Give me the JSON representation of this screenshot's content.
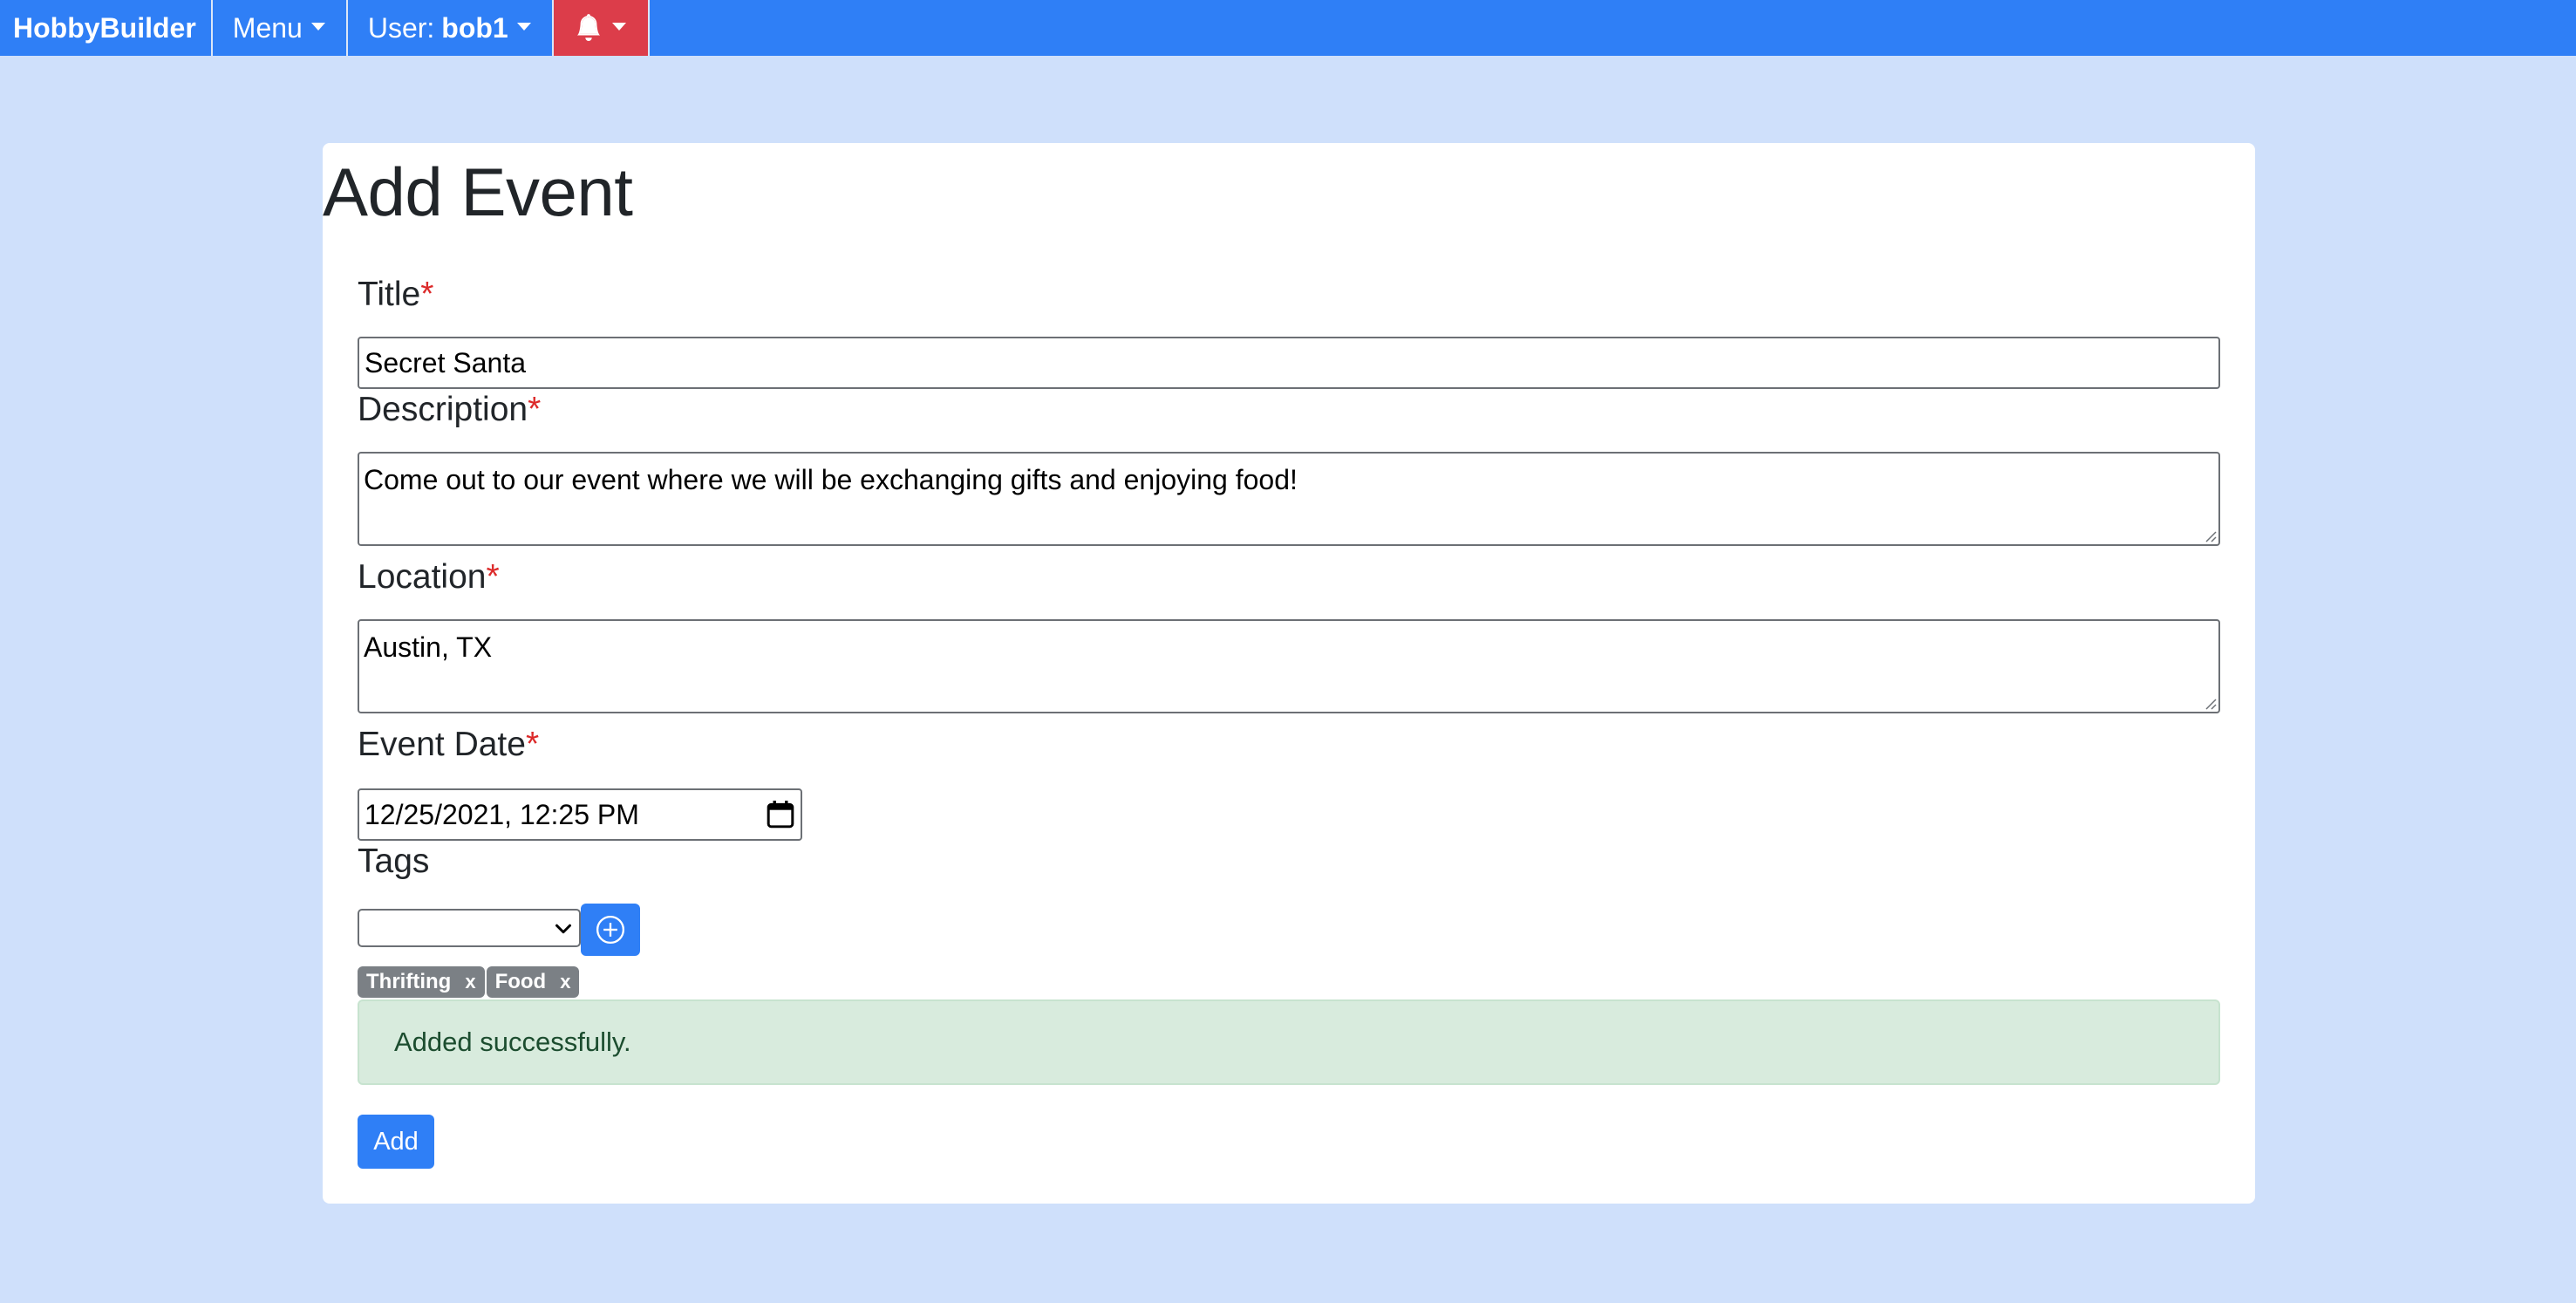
{
  "navbar": {
    "brand": "HobbyBuilder",
    "menu_label": "Menu",
    "user_prefix": "User:",
    "username": "bob1",
    "notifications_icon": "bell-icon"
  },
  "form": {
    "page_title": "Add Event",
    "required_marker": "*",
    "title": {
      "label": "Title",
      "value": "Secret Santa"
    },
    "description": {
      "label": "Description",
      "value": "Come out to our event where we will be exchanging gifts and enjoying food!"
    },
    "location": {
      "label": "Location",
      "value": "Austin, TX"
    },
    "event_date": {
      "label": "Event Date",
      "value": "12/25/2021, 12:25 PM",
      "icon": "calendar-icon"
    },
    "tags": {
      "label": "Tags",
      "selected": "",
      "add_icon": "plus-circle-icon",
      "items": [
        {
          "name": "Thrifting",
          "remove": "x"
        },
        {
          "name": "Food",
          "remove": "x"
        }
      ]
    },
    "alert": "Added successfully.",
    "submit_label": "Add"
  },
  "colors": {
    "primary": "#2f7ff6",
    "danger": "#dc3d4a",
    "background": "#cfe0fb",
    "tag_badge": "#7b8085",
    "success_bg": "#d8ebdd",
    "success_text": "#1c4d2f",
    "required": "#dc2a2a"
  }
}
